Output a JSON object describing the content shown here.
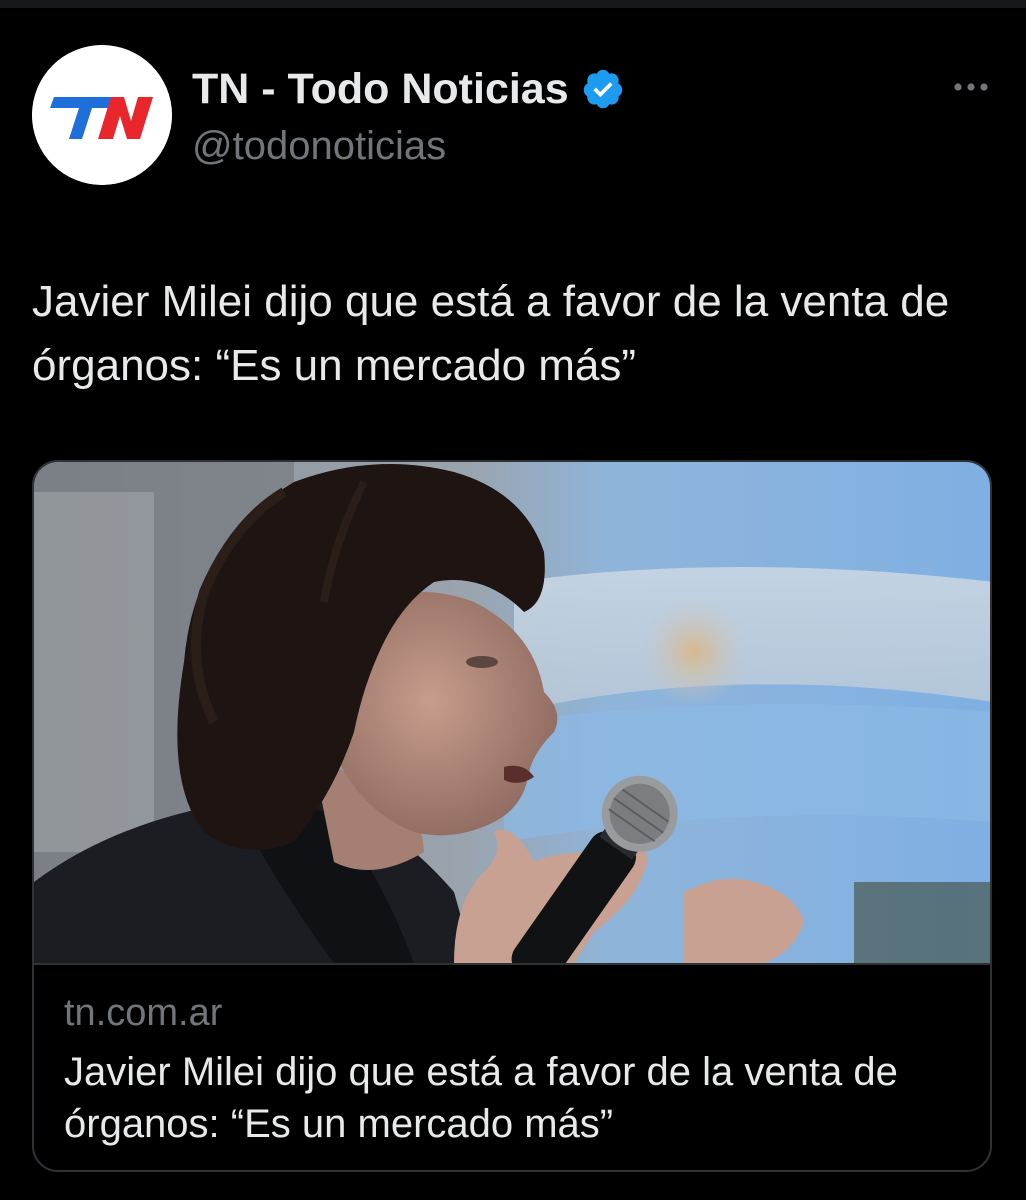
{
  "account": {
    "display_name": "TN - Todo Noticias",
    "handle": "@todonoticias",
    "avatar_logo_text": "TN",
    "verified": true
  },
  "tweet": {
    "text": "Javier Milei dijo que está a favor de la venta de órganos: “Es un mercado más”"
  },
  "link_card": {
    "domain": "tn.com.ar",
    "title": "Javier Milei dijo que está a favor de la venta de órganos: “Es un mercado más”"
  },
  "icons": {
    "verified": "verified-badge-icon",
    "more": "more-options-icon"
  },
  "colors": {
    "background": "#000000",
    "text_primary": "#e7e9ea",
    "text_secondary": "#71767b",
    "verified_blue": "#1d9bf0",
    "card_border": "#2f3336",
    "logo_blue": "#1e6fd9",
    "logo_red": "#e8262b"
  }
}
